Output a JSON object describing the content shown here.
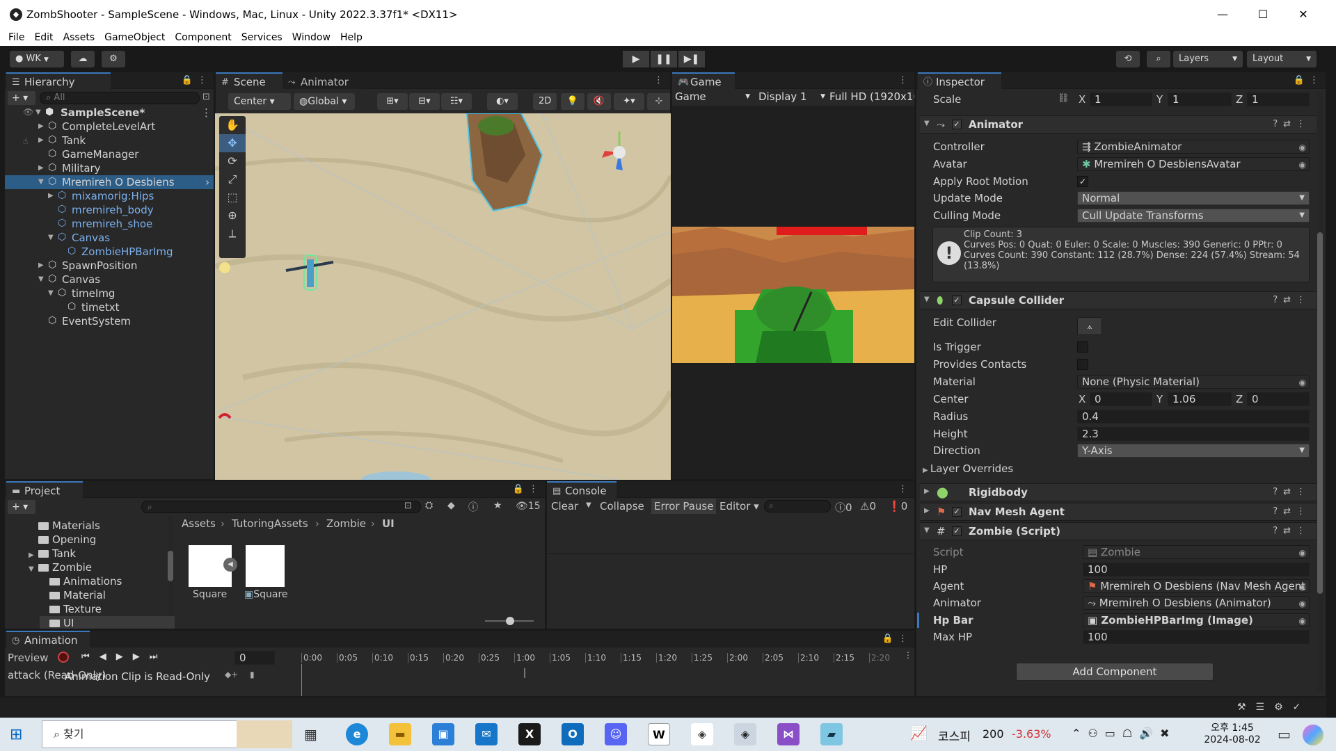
{
  "window": {
    "title": "ZombShooter - SampleScene - Windows, Mac, Linux - Unity 2022.3.37f1* <DX11>",
    "min_label": "—",
    "max_label": "☐",
    "close_label": "✕"
  },
  "menu": [
    "File",
    "Edit",
    "Assets",
    "GameObject",
    "Component",
    "Services",
    "Window",
    "Help"
  ],
  "toolbar": {
    "account": "WK",
    "layers": "Layers",
    "layout": "Layout"
  },
  "hierarchy": {
    "tab": "Hierarchy",
    "search_placeholder": "All",
    "scene_name": "SampleScene*",
    "items": [
      {
        "label": "CompleteLevelArt",
        "depth": 1,
        "arrow": "▶",
        "blue": false
      },
      {
        "label": "Tank",
        "depth": 1,
        "arrow": "▶",
        "blue": false
      },
      {
        "label": "GameManager",
        "depth": 1,
        "arrow": "",
        "blue": false
      },
      {
        "label": "Military",
        "depth": 1,
        "arrow": "▶",
        "blue": false
      },
      {
        "label": "Mremireh O Desbiens",
        "depth": 1,
        "arrow": "▼",
        "blue": false,
        "selected": true
      },
      {
        "label": "mixamorig:Hips",
        "depth": 2,
        "arrow": "▶",
        "blue": true
      },
      {
        "label": "mremireh_body",
        "depth": 2,
        "arrow": "",
        "blue": true
      },
      {
        "label": "mremireh_shoe",
        "depth": 2,
        "arrow": "",
        "blue": true
      },
      {
        "label": "Canvas",
        "depth": 2,
        "arrow": "▼",
        "blue": true
      },
      {
        "label": "ZombieHPBarImg",
        "depth": 3,
        "arrow": "",
        "blue": true
      },
      {
        "label": "SpawnPosition",
        "depth": 1,
        "arrow": "▶",
        "blue": false
      },
      {
        "label": "Canvas",
        "depth": 1,
        "arrow": "▼",
        "blue": false
      },
      {
        "label": "timeImg",
        "depth": 2,
        "arrow": "▼",
        "blue": false
      },
      {
        "label": "timetxt",
        "depth": 3,
        "arrow": "",
        "blue": false
      },
      {
        "label": "EventSystem",
        "depth": 1,
        "arrow": "",
        "blue": false
      }
    ]
  },
  "scene": {
    "tab_scene": "Scene",
    "tab_animator": "Animator",
    "pivot": "Center",
    "space": "Global",
    "mode_2d": "2D"
  },
  "game": {
    "tab": "Game",
    "mode": "Game",
    "display": "Display 1",
    "resolution": "Full HD (1920x10"
  },
  "inspector": {
    "tab": "Inspector",
    "scale": {
      "label": "Scale",
      "x": "1",
      "y": "1",
      "z": "1"
    },
    "animator": {
      "title": "Animator",
      "controller_label": "Controller",
      "controller": "ZombieAnimator",
      "avatar_label": "Avatar",
      "avatar": "Mremireh O DesbiensAvatar",
      "apply_root_motion_label": "Apply Root Motion",
      "update_mode_label": "Update Mode",
      "update_mode": "Normal",
      "culling_mode_label": "Culling Mode",
      "culling_mode": "Cull Update Transforms",
      "info_1": "Clip Count: 3",
      "info_2": "Curves Pos: 0 Quat: 0 Euler: 0 Scale: 0 Muscles: 390 Generic: 0 PPtr: 0",
      "info_3": "Curves Count: 390 Constant: 112 (28.7%) Dense: 224 (57.4%) Stream: 54",
      "info_4": "(13.8%)"
    },
    "capsule": {
      "title": "Capsule Collider",
      "edit_collider_label": "Edit Collider",
      "is_trigger_label": "Is Trigger",
      "provides_contacts_label": "Provides Contacts",
      "material_label": "Material",
      "material": "None (Physic Material)",
      "center_label": "Center",
      "center_x": "0",
      "center_y": "1.06",
      "center_z": "0",
      "radius_label": "Radius",
      "radius": "0.4",
      "height_label": "Height",
      "height": "2.3",
      "direction_label": "Direction",
      "direction": "Y-Axis",
      "layer_overrides_label": "Layer Overrides"
    },
    "rigidbody": {
      "title": "Rigidbody"
    },
    "navmesh": {
      "title": "Nav Mesh Agent"
    },
    "zombie": {
      "title": "Zombie (Script)",
      "script_label": "Script",
      "script": "Zombie",
      "hp_label": "HP",
      "hp": "100",
      "agent_label": "Agent",
      "agent": "Mremireh O Desbiens (Nav Mesh Agent",
      "animator_label": "Animator",
      "animator": "Mremireh O Desbiens (Animator)",
      "hpbar_label": "Hp Bar",
      "hpbar": "ZombieHPBarImg (Image)",
      "maxhp_label": "Max HP",
      "maxhp": "100"
    },
    "add_component": "Add Component"
  },
  "project": {
    "tab": "Project",
    "hidden_count": "15",
    "tree": [
      {
        "label": "Materials",
        "depth": 2,
        "arrow": ""
      },
      {
        "label": "Opening",
        "depth": 2,
        "arrow": ""
      },
      {
        "label": "Tank",
        "depth": 2,
        "arrow": "▶"
      },
      {
        "label": "Zombie",
        "depth": 2,
        "arrow": "▼"
      },
      {
        "label": "Animations",
        "depth": 3,
        "arrow": ""
      },
      {
        "label": "Material",
        "depth": 3,
        "arrow": ""
      },
      {
        "label": "Texture",
        "depth": 3,
        "arrow": ""
      },
      {
        "label": "UI",
        "depth": 3,
        "arrow": ""
      }
    ],
    "breadcrumb": [
      "Assets",
      "TutoringAssets",
      "Zombie",
      "UI"
    ],
    "assets": [
      {
        "label": "Square"
      },
      {
        "label": "Square"
      }
    ]
  },
  "console": {
    "tab": "Console",
    "clear": "Clear",
    "collapse": "Collapse",
    "error_pause": "Error Pause",
    "editor": "Editor",
    "count_info": "0",
    "count_warn": "0",
    "count_err": "0"
  },
  "animation": {
    "tab": "Animation",
    "preview": "Preview",
    "frame": "0",
    "clip": "attack (Read-Only)",
    "overlay": "Animation Clip is Read-Only",
    "ticks": [
      "0:00",
      "0:05",
      "0:10",
      "0:15",
      "0:20",
      "0:25",
      "1:00",
      "1:05",
      "1:10",
      "1:15",
      "1:20",
      "1:25",
      "2:00",
      "2:05",
      "2:10",
      "2:15",
      "2:20"
    ]
  },
  "taskbar": {
    "search": "찾기",
    "stock_name": "코스피",
    "stock_value": "200",
    "stock_change": "-3.63%",
    "time": "오후 1:45",
    "date": "2024-08-02"
  }
}
